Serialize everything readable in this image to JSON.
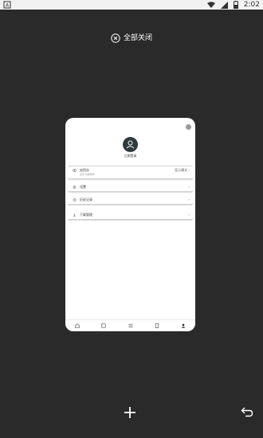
{
  "status_bar": {
    "left_icon": "a-icon",
    "time": "2:02",
    "icons": [
      "wifi-icon",
      "signal-icon",
      "battery-icon"
    ]
  },
  "close_all": {
    "label": "全部关闭",
    "icon": "circle-x-icon"
  },
  "card": {
    "username": "立即登录",
    "rows": [
      {
        "icon": "eye-icon",
        "title": "启用次",
        "subtitle": "点击 切换账号",
        "right": "显示模式 ›"
      },
      {
        "icon": "gear-icon",
        "title": "设置",
        "right": "›"
      },
      {
        "icon": "clock-icon",
        "title": "历史记录",
        "right": "›"
      },
      {
        "icon": "download-icon",
        "title": "下载管理",
        "right": "›"
      }
    ],
    "nav_icons": [
      "home-icon",
      "book-icon",
      "menu-icon",
      "doc-icon",
      "user-icon"
    ]
  },
  "bottom": {
    "add_icon": "plus-icon",
    "back_icon": "return-arrow-icon"
  },
  "colors": {
    "background": "#2b2a2a",
    "card": "#ffffff",
    "status_bar": "#f2f2f2"
  }
}
